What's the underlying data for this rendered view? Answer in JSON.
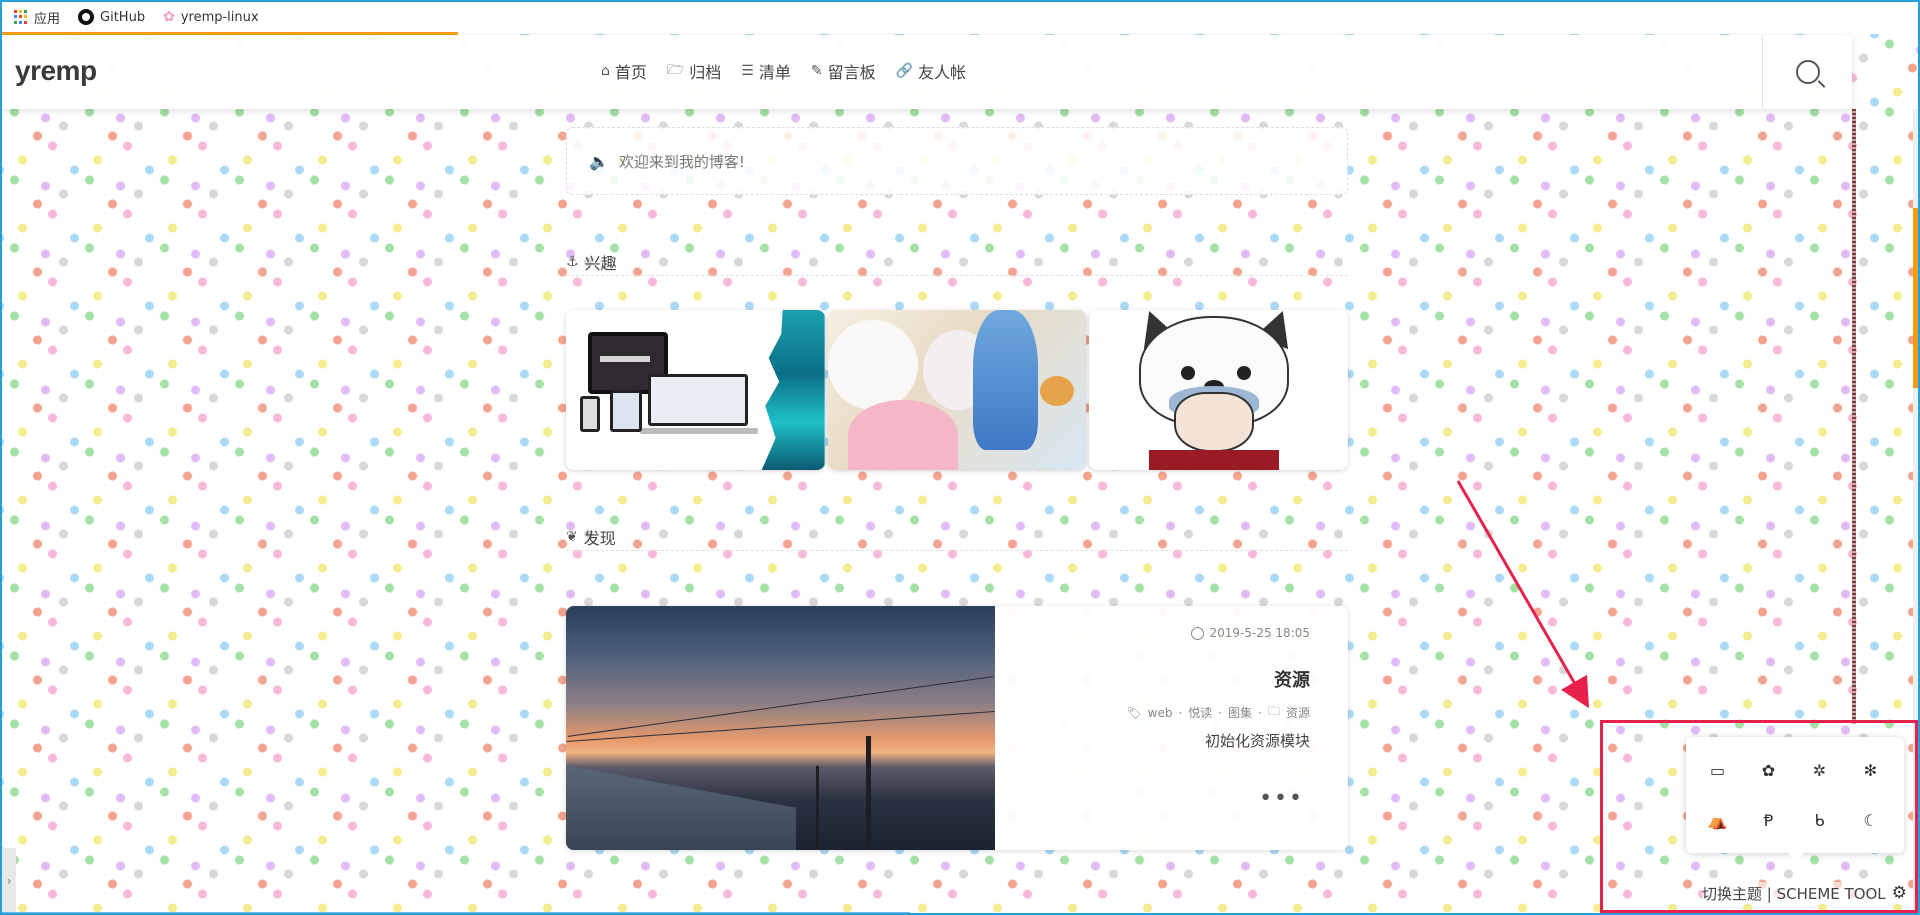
{
  "bookmarks": [
    {
      "label": "应用",
      "icon": "apps-grid-icon"
    },
    {
      "label": "GitHub",
      "icon": "github-icon"
    },
    {
      "label": "yremp-linux",
      "icon": "sakura-icon"
    }
  ],
  "site": {
    "logo": "yremp"
  },
  "nav": [
    {
      "label": "首页",
      "icon": "home-icon",
      "glyph": "⌂"
    },
    {
      "label": "归档",
      "icon": "folder-open-icon",
      "glyph": "🗁"
    },
    {
      "label": "清单",
      "icon": "list-icon",
      "glyph": "☰"
    },
    {
      "label": "留言板",
      "icon": "edit-icon",
      "glyph": "✎"
    },
    {
      "label": "友人帐",
      "icon": "link-icon",
      "glyph": "🔗"
    }
  ],
  "notice": {
    "text": "欢迎来到我的博客!"
  },
  "sections": {
    "interest": "兴趣",
    "discover": "发现"
  },
  "post": {
    "date": "2019-5-25 18:05",
    "title": "资源",
    "tags": [
      "web",
      "·",
      "悦读",
      "·",
      "图集",
      "·"
    ],
    "category": "资源",
    "excerpt": "初始化资源模块",
    "more": "•••"
  },
  "theme_tool": {
    "buttons": [
      {
        "icon": "monitor-icon",
        "glyph": "▭"
      },
      {
        "icon": "flower-icon",
        "glyph": "✿"
      },
      {
        "icon": "gear-flower-icon",
        "glyph": "✲"
      },
      {
        "icon": "snowflake-icon",
        "glyph": "✻"
      },
      {
        "icon": "tent-icon",
        "glyph": "⛺"
      },
      {
        "icon": "pixiv-icon",
        "glyph": "Ᵽ"
      },
      {
        "icon": "bing-icon",
        "glyph": "ᑲ"
      },
      {
        "icon": "moon-icon",
        "glyph": "☾"
      }
    ],
    "label": "切换主题 | SCHEME TOOL"
  },
  "colors": {
    "accent": "#f39c12",
    "highlight": "#e8204c",
    "window_border": "#26a0da"
  }
}
